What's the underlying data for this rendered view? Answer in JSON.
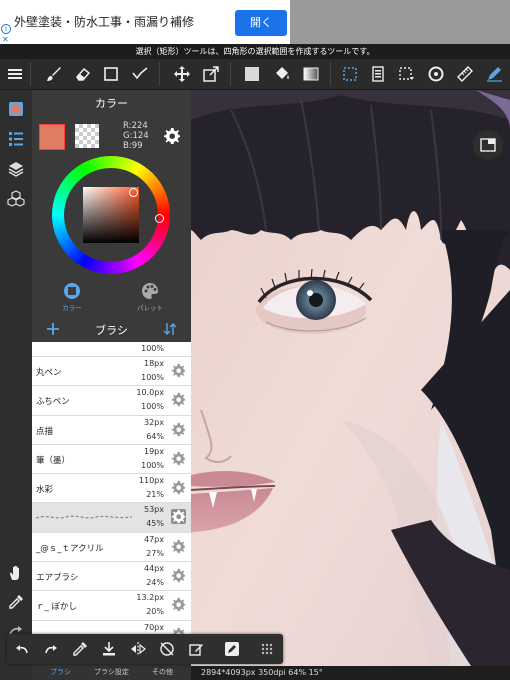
{
  "ad": {
    "text": "外壁塗装・防水工事・雨漏り補修",
    "button": "開く",
    "info_icon": "i",
    "close_icon": "✕"
  },
  "hint": "選択（矩形）ツールは、四角形の選択範囲を作成するツールです。",
  "color_panel": {
    "title": "カラー",
    "main_color": "#e07c63",
    "rgb": {
      "r": "R:224",
      "g": "G:124",
      "b": "B:99"
    },
    "tabs": [
      {
        "label": "カラー",
        "icon": "color-wheel-icon",
        "active": true
      },
      {
        "label": "パレット",
        "icon": "palette-icon",
        "active": false
      }
    ]
  },
  "brush_panel": {
    "title": "ブラシ",
    "brushes": [
      {
        "name": "",
        "size": "",
        "opacity": "100%",
        "selected": false
      },
      {
        "name": "丸ペン",
        "size": "18px",
        "opacity": "100%",
        "selected": false
      },
      {
        "name": "ふちペン",
        "size": "10.0px",
        "opacity": "100%",
        "selected": false
      },
      {
        "name": "点描",
        "size": "32px",
        "opacity": "64%",
        "selected": false
      },
      {
        "name": "筆（墨）",
        "size": "19px",
        "opacity": "100%",
        "selected": false
      },
      {
        "name": "水彩",
        "size": "110px",
        "opacity": "21%",
        "selected": false
      },
      {
        "name": "",
        "size": "53px",
        "opacity": "45%",
        "selected": true
      },
      {
        "name": "_@ｓ_ｔアクリル",
        "size": "47px",
        "opacity": "27%",
        "selected": false
      },
      {
        "name": "エアブラシ",
        "size": "44px",
        "opacity": "24%",
        "selected": false
      },
      {
        "name": "ｒ_ ぼかし",
        "size": "13.2px",
        "opacity": "20%",
        "selected": false
      },
      {
        "name": "",
        "size": "70px",
        "opacity": "",
        "selected": false
      }
    ],
    "bottom_tabs": [
      "ブラシ",
      "ブラシ設定",
      "その他"
    ]
  },
  "status_bar": "2894*4093px 350dpi 64% 15°",
  "colors": {
    "accent_blue": "#5aa7e8",
    "toolbar_bg": "#2b2b2b",
    "panel_bg": "#3a3a3a"
  }
}
